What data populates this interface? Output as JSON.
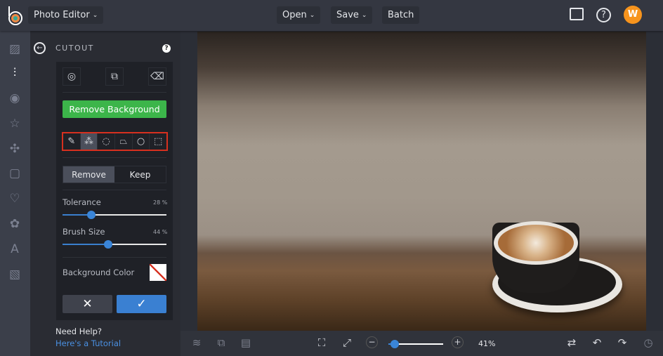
{
  "header": {
    "app_menu": "Photo Editor",
    "open": "Open",
    "save": "Save",
    "batch": "Batch",
    "avatar_initial": "W"
  },
  "panel": {
    "title": "CUTOUT",
    "remove_background": "Remove Background",
    "mode_remove": "Remove",
    "mode_keep": "Keep",
    "tolerance_label": "Tolerance",
    "tolerance_value": "28 %",
    "tolerance": 28,
    "brush_label": "Brush Size",
    "brush_value": "44 %",
    "brush": 44,
    "bg_color_label": "Background Color",
    "help_title": "Need Help?",
    "help_link": "Here's a Tutorial"
  },
  "toolbar": {
    "zoom_label": "41%",
    "zoom": 41
  },
  "colors": {
    "accent": "#3a85d8",
    "green": "#3cb54a",
    "highlight": "#d7301f",
    "avatar": "#f7941d"
  }
}
